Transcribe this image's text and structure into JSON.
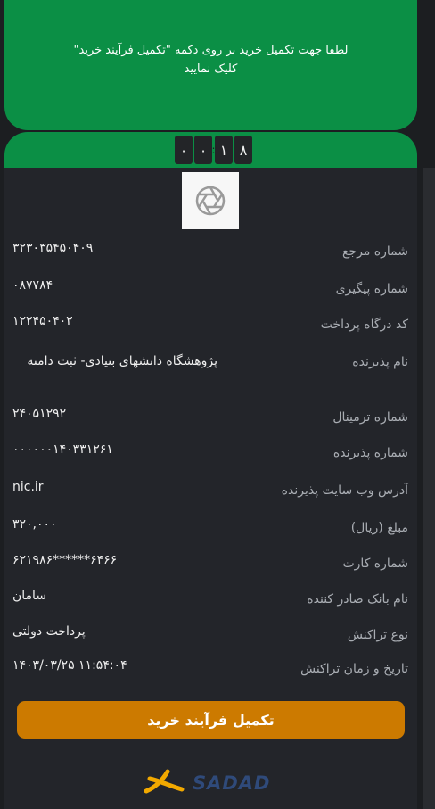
{
  "banner": {
    "message": "لطفا جهت تکمیل خرید بر روی دکمه \"تکمیل فرآیند خرید\" کلیک نمایید"
  },
  "timer": {
    "digits": [
      "۰",
      "۰",
      "۱",
      "۸"
    ]
  },
  "receipt": {
    "rows": [
      {
        "label": "شماره مرجع",
        "value": "۳۲۳۰۳۵۴۵۰۴۰۹"
      },
      {
        "label": "شماره پیگیری",
        "value": "۰۸۷۷۸۴"
      },
      {
        "label": "کد درگاه پرداخت",
        "value": "۱۲۲۴۵۰۴۰۲"
      },
      {
        "label": "نام پذیرنده",
        "value": "پژوهشگاه دانشهای بنیادی- ثبت دامنه"
      },
      {
        "label": "شماره ترمینال",
        "value": "۲۴۰۵۱۲۹۲"
      },
      {
        "label": "شماره پذیرنده",
        "value": "۰۰۰۰۰۰۱۴۰۳۳۱۲۶۱"
      },
      {
        "label": "آدرس وب سایت پذیرنده",
        "value": "nic.ir"
      },
      {
        "label": "مبلغ (ریال)",
        "value": "۳۲۰,۰۰۰"
      },
      {
        "label": "شماره کارت",
        "value": "۶۲۱۹۸۶******۶۴۶۶"
      },
      {
        "label": "نام بانک صادر کننده",
        "value": "سامان"
      },
      {
        "label": "نوع تراکنش",
        "value": "پرداخت دولتی"
      },
      {
        "label": "تاریخ و زمان تراکنش",
        "value": "۱۴۰۳/۰۳/۲۵ ۱۱:۵۴:۰۴"
      }
    ]
  },
  "actions": {
    "complete_label": "تکمیل فرآیند خرید"
  },
  "footer": {
    "brand": "SADAD"
  },
  "colors": {
    "green": "#0b8f45",
    "orange": "#cc7a00",
    "background": "#1c1e21"
  }
}
